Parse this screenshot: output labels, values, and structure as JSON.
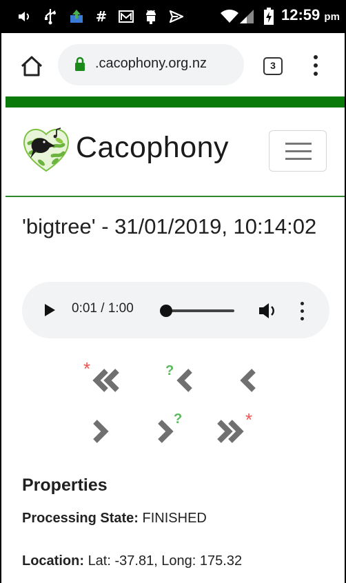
{
  "status_bar": {
    "time": "12:59",
    "ampm": "pm",
    "icons": [
      "volume-icon",
      "usb-icon",
      "upload-icon",
      "hash-icon",
      "mail-icon",
      "android-icon",
      "send-icon",
      "wifi-icon",
      "signal-icon",
      "battery-charging-icon"
    ]
  },
  "browser": {
    "url": ".cacophony.org.nz",
    "tab_count": "3",
    "accent_color": "#0a7a0a"
  },
  "site": {
    "brand": "Cacophony"
  },
  "recording": {
    "title": "'bigtree' - 31/01/2019, 10:14:02",
    "player": {
      "time": "0:01 / 1:00",
      "progress": 0.017
    }
  },
  "navigation": {
    "star_glyph": "*",
    "question_glyph": "?",
    "star_color": "#ef5350",
    "question_color": "#5cb85c",
    "arrow_color": "#707070"
  },
  "properties": {
    "heading": "Properties",
    "items": [
      {
        "label": "Processing State:",
        "value": "FINISHED"
      },
      {
        "label": "Location:",
        "value": "Lat: -37.81, Long: 175.32"
      }
    ]
  }
}
